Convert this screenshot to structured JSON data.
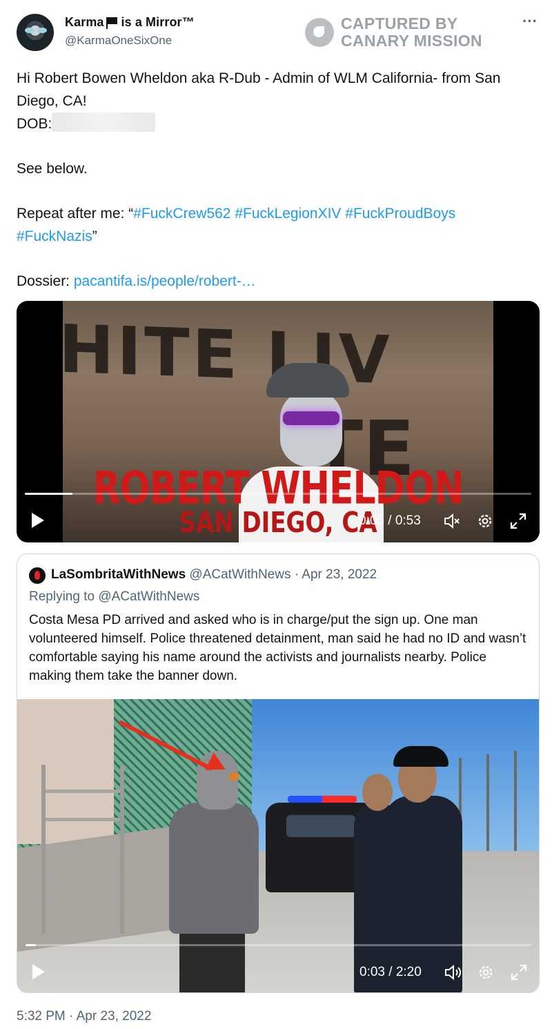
{
  "author": {
    "name_part1": "Karma",
    "name_part2": "is a Mirror™",
    "flag_icon": "black-flag-icon",
    "handle": "@KarmaOneSixOne"
  },
  "watermark": {
    "line1": "CAPTURED BY",
    "line2": "CANARY MISSION"
  },
  "tweet": {
    "line1": "Hi Robert Bowen Wheldon aka R-Dub - Admin of WLM California- from San Diego, CA!",
    "dob_label": "DOB:",
    "line_see": "See below.",
    "repeat_prefix": "Repeat after me: “",
    "hashtags": [
      "#FuckCrew562",
      "#FuckLegionXIV",
      "#FuckProudBoys",
      "#FuckNazis"
    ],
    "repeat_suffix": "”",
    "dossier_label": "Dossier:",
    "dossier_link": "pacantifa.is/people/robert-…"
  },
  "video1": {
    "banner_top": "HITE LIV",
    "banner_bottom": "TE",
    "overlay_name": "ROBERT WHELDON",
    "overlay_city": "SAN DIEGO, CA",
    "time": "0:05 / 0:53",
    "progress": 0.094
  },
  "quoted": {
    "name": "LaSombritaWithNews",
    "meta": " @ACatWithNews · Apr 23, 2022",
    "reply": "Replying to @ACatWithNews",
    "text": "Costa Mesa PD arrived and asked who is in charge/put the sign up. One man volunteered himself. Police threatened detainment, man said he had no ID and wasn’t comfortable saying his name around the activists and journalists nearby. Police making them take the banner down.",
    "video_time": "0:03 / 2:20",
    "progress": 0.021
  },
  "timestamp": "5:32 PM · Apr 23, 2022",
  "colors": {
    "link": "#1d9bf0",
    "muted": "#536471",
    "overlay_red": "#d01a1a"
  },
  "icons": [
    "more-icon",
    "play-icon",
    "muted-icon",
    "volume-icon",
    "settings-icon",
    "fullscreen-icon"
  ]
}
